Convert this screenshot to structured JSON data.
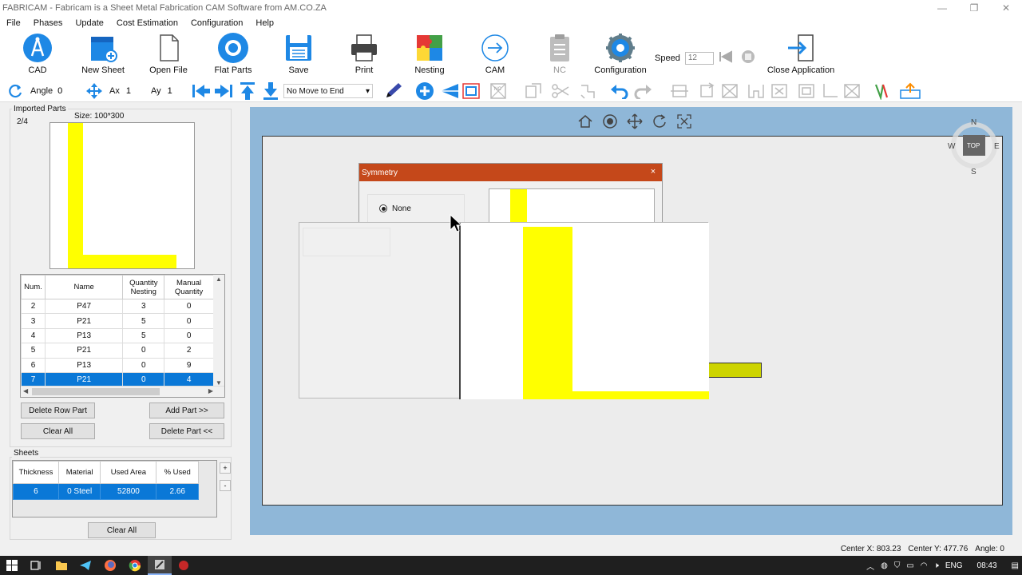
{
  "window": {
    "title": "FABRICAM - Fabricam is a Sheet Metal Fabrication CAM Software from AM.CO.ZA",
    "minimize": "—",
    "maximize": "❐",
    "close": "✕"
  },
  "menu": [
    "File",
    "Phases",
    "Update",
    "Cost Estimation",
    "Configuration",
    "Help"
  ],
  "ribbon": {
    "cad": "CAD",
    "new_sheet": "New Sheet",
    "open_file": "Open File",
    "flat_parts": "Flat Parts",
    "save": "Save",
    "print": "Print",
    "nesting": "Nesting",
    "cam": "CAM",
    "nc": "NC",
    "configuration": "Configuration",
    "speed_label": "Speed",
    "speed_value": "12",
    "close_app": "Close Application"
  },
  "toolbar": {
    "angle_label": "Angle",
    "angle_value": "0",
    "ax_label": "Ax",
    "ax_value": "1",
    "ay_label": "Ay",
    "ay_value": "1",
    "move_select": "No Move to End",
    "nc_small": "NC"
  },
  "imported_parts": {
    "label": "Imported Parts",
    "counter": "2/4",
    "size": "Size: 100*300",
    "columns": [
      "Num.",
      "Name",
      "Quantity Nesting",
      "Manual Quantity"
    ],
    "rows": [
      {
        "num": "2",
        "name": "P47",
        "qn": "3",
        "mq": "0"
      },
      {
        "num": "3",
        "name": "P21",
        "qn": "5",
        "mq": "0"
      },
      {
        "num": "4",
        "name": "P13",
        "qn": "5",
        "mq": "0"
      },
      {
        "num": "5",
        "name": "P21",
        "qn": "0",
        "mq": "2"
      },
      {
        "num": "6",
        "name": "P13",
        "qn": "0",
        "mq": "9"
      },
      {
        "num": "7",
        "name": "P21",
        "qn": "0",
        "mq": "4"
      }
    ],
    "selected_row": 5
  },
  "buttons": {
    "delete_row": "Delete Row Part",
    "add_part": "Add Part >>",
    "clear_all": "Clear All",
    "delete_part": "Delete Part <<",
    "sheets_clear_all": "Clear All"
  },
  "sheets": {
    "label": "Sheets",
    "columns": [
      "Thickness",
      "Material",
      "Used Area",
      "% Used"
    ],
    "row": {
      "thickness": "6",
      "material": "0   Steel",
      "used_area": "52800",
      "used": "2.66"
    },
    "plus": "+",
    "minus": "-"
  },
  "compass": {
    "n": "N",
    "s": "S",
    "e": "E",
    "w": "W",
    "top": "TOP"
  },
  "dialog": {
    "title": "Symmetry",
    "close": "×",
    "option_none": "None"
  },
  "status": {
    "center_x": "Center X: 803.23",
    "center_y": "Center Y: 477.76",
    "angle": "Angle: 0"
  },
  "taskbar": {
    "lang": "ENG",
    "time": "08:43"
  },
  "colors": {
    "part_yellow": "#ffff00",
    "selection_blue": "#0a78d7",
    "dialog_title": "#c5481a",
    "viewport_blue": "#8fb7d8"
  }
}
